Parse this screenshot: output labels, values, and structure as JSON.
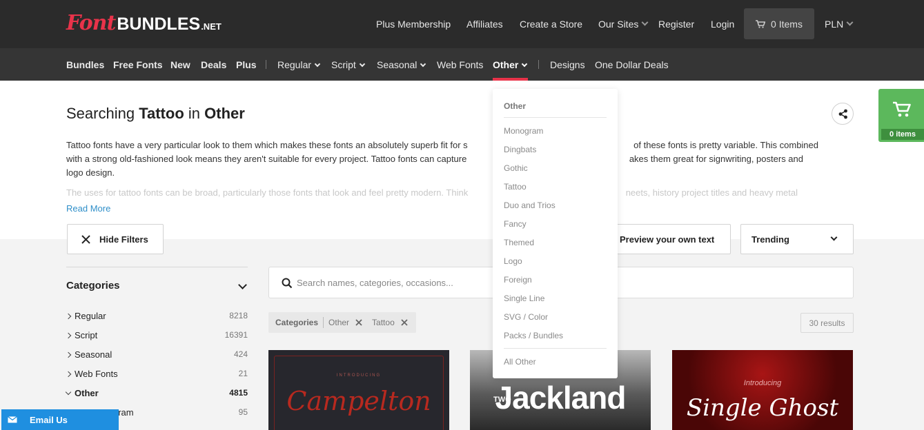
{
  "logo": {
    "font": "Font",
    "bundles": "BUNDLES",
    "net": ".NET"
  },
  "topnav": {
    "plus_membership": "Plus Membership",
    "affiliates": "Affiliates",
    "create_store": "Create a Store",
    "our_sites": "Our Sites",
    "register": "Register",
    "login": "Login",
    "cart": "0 Items",
    "currency": "PLN"
  },
  "subnav": {
    "bundles": "Bundles",
    "free_fonts": "Free Fonts",
    "new": "New",
    "deals": "Deals",
    "plus": "Plus",
    "regular": "Regular",
    "script": "Script",
    "seasonal": "Seasonal",
    "web_fonts": "Web Fonts",
    "other": "Other",
    "designs": "Designs",
    "one_dollar": "One Dollar Deals"
  },
  "header": {
    "title_pre": "Searching ",
    "title_term": "Tattoo",
    "title_mid": " in ",
    "title_cat": "Other",
    "desc_1": "Tattoo fonts have a very particular look to them which makes these fonts an absolutely superb fit for s",
    "desc_1b": "of these fonts is pretty variable. This combined",
    "desc_2": "with a strong old-fashioned look means they aren't suitable for every project. Tattoo fonts can capture",
    "desc_2b": "akes them great for signwriting, posters and",
    "desc_3": "logo design.",
    "desc_fade": "The uses for tattoo fonts can be broad, particularly those fonts that look and feel pretty modern. Think",
    "desc_fade_b": "neets, history project titles and heavy metal",
    "read_more": "Read More"
  },
  "controls": {
    "hide_filters": "Hide Filters",
    "preview": "Preview your own text",
    "sort": "Trending"
  },
  "sidebar": {
    "title": "Categories",
    "items": [
      {
        "label": "Regular",
        "count": "8218"
      },
      {
        "label": "Script",
        "count": "16391"
      },
      {
        "label": "Seasonal",
        "count": "424"
      },
      {
        "label": "Web Fonts",
        "count": "21"
      },
      {
        "label": "Other",
        "count": "4815"
      },
      {
        "label": "gram",
        "count": "95"
      }
    ]
  },
  "search": {
    "placeholder": "Search names, categories, occasions..."
  },
  "filters": {
    "label": "Categories",
    "chip1": "Other",
    "chip2": "Tattoo"
  },
  "results": "30 results",
  "cards": [
    {
      "title": "Campelton",
      "intro": "INTRODUCING"
    },
    {
      "title": "Jackland",
      "tag": "TWO"
    },
    {
      "title": "Single Ghost",
      "intro": "Introducing"
    }
  ],
  "dropdown": {
    "header": "Other",
    "items": [
      "Monogram",
      "Dingbats",
      "Gothic",
      "Tattoo",
      "Duo and Trios",
      "Fancy",
      "Themed",
      "Logo",
      "Foreign",
      "Single Line",
      "SVG / Color",
      "Packs / Bundles"
    ],
    "all": "All Other"
  },
  "float_cart": "0 items",
  "email": "Email Us",
  "colors": {
    "accent": "#e8334a",
    "cart_green": "#5cb85c",
    "link": "#2f8fc9",
    "email_blue": "#1f8fe0"
  }
}
